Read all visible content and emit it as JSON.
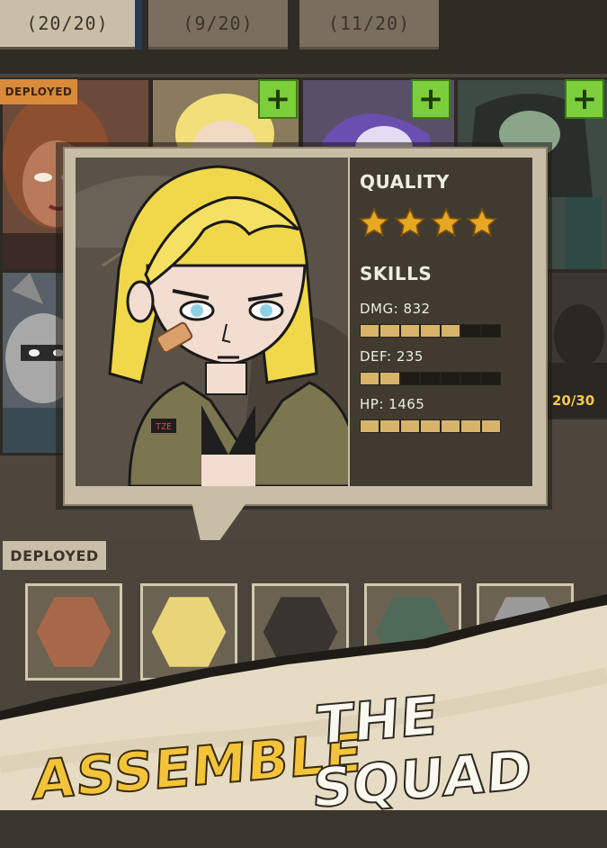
{
  "tabs": [
    {
      "label": "(20/20)",
      "active": true
    },
    {
      "label": "(9/20)",
      "active": false
    },
    {
      "label": "(11/20)",
      "active": false
    }
  ],
  "hero_grid": {
    "deployed_tag": "DEPLOYED",
    "count_label": "20/30",
    "add_buttons": [
      "+",
      "+",
      "+"
    ]
  },
  "popup": {
    "quality_title": "QUALITY",
    "stars": 4,
    "skills_title": "SKILLS",
    "stats": [
      {
        "label": "DMG: 832",
        "segments_filled": 5,
        "segments_total": 7
      },
      {
        "label": "DEF: 235",
        "segments_filled": 2,
        "segments_total": 7
      },
      {
        "label": "HP: 1465",
        "segments_filled": 7,
        "segments_total": 7
      }
    ],
    "jacket_patch": "TZE"
  },
  "deployed": {
    "label": "DEPLOYED",
    "slots": 5
  },
  "banner": {
    "word1": "ASSEMBLE",
    "word2": "THE SQUAD"
  },
  "colors": {
    "accent_yellow": "#f3c43a",
    "star_gold": "#e6a823",
    "plus_green": "#7ccf3a",
    "deployed_orange": "#d98b3a",
    "paper": "#e8dfc9"
  }
}
